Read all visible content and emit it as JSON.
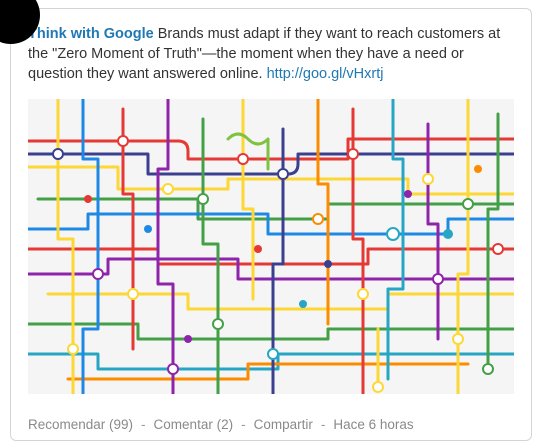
{
  "post": {
    "author": "Think with Google",
    "text": " Brands must adapt if they want to reach customers at the \"Zero Moment of Truth\"—the moment when they have a need or question they want answered online. ",
    "link": "http://goo.gl/vHxrtj",
    "image": {
      "name": "transit-map-illustration",
      "colors": [
        "#e53935",
        "#1e88e5",
        "#fdd835",
        "#43a047",
        "#8e24aa",
        "#fb8c00",
        "#3a3f8f",
        "#26a6c4",
        "#7fc241"
      ]
    }
  },
  "actions": {
    "recommend": "Recomendar (99)",
    "comment": "Comentar (2)",
    "share": "Compartir",
    "separator": "-",
    "time": "Hace 6 horas"
  }
}
